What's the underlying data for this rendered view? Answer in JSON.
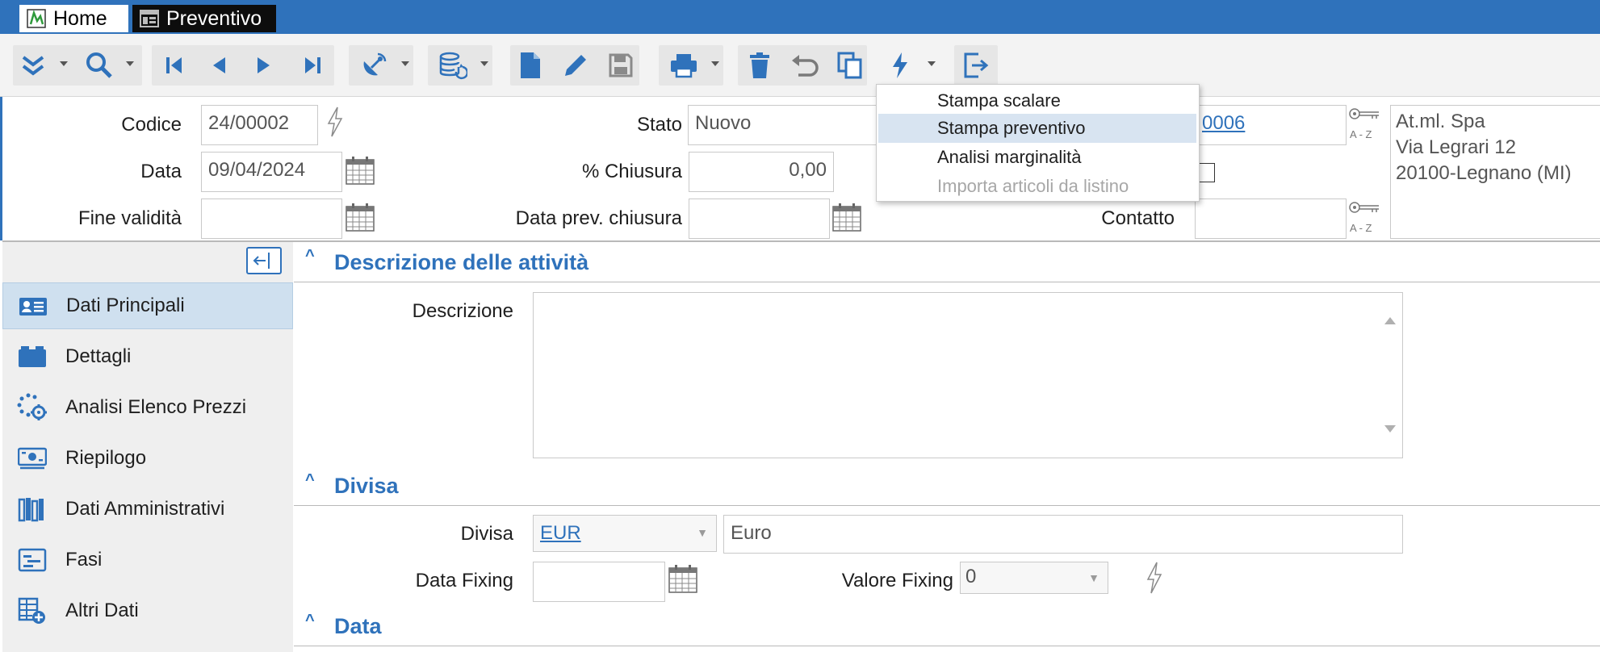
{
  "tabs": [
    {
      "label": "Home"
    },
    {
      "label": "Preventivo"
    }
  ],
  "header": {
    "codice_label": "Codice",
    "codice_value": "24/00002",
    "data_label": "Data",
    "data_value": "09/04/2024",
    "fine_label": "Fine validità",
    "fine_value": "",
    "stato_label": "Stato",
    "stato_value": "Nuovo",
    "chiusura_label": "% Chiusura",
    "chiusura_value": "0,00",
    "data_prev_label": "Data prev. chiusura",
    "data_prev_value": "",
    "cliente_code": "0006",
    "contatto_label": "Contatto",
    "contatto_value": "",
    "address_line1": "At.ml. Spa",
    "address_line2": "Via Legrari 12",
    "address_line3": "20100-Legnano (MI)"
  },
  "dropdown": {
    "items": [
      {
        "label": "Stampa scalare",
        "state": "normal"
      },
      {
        "label": "Stampa preventivo",
        "state": "selected"
      },
      {
        "label": "Analisi marginalità",
        "state": "normal"
      },
      {
        "label": "Importa articoli da listino",
        "state": "disabled"
      }
    ]
  },
  "sidebar": {
    "items": [
      {
        "label": "Dati Principali",
        "icon": "id-card-icon"
      },
      {
        "label": "Dettagli",
        "icon": "folder-icon"
      },
      {
        "label": "Analisi Elenco Prezzi",
        "icon": "dots-gear-icon"
      },
      {
        "label": "Riepilogo",
        "icon": "banknote-icon"
      },
      {
        "label": "Dati Amministrativi",
        "icon": "books-icon"
      },
      {
        "label": "Fasi",
        "icon": "list-icon"
      },
      {
        "label": "Altri Dati",
        "icon": "table-add-icon"
      }
    ]
  },
  "sections": {
    "descrizione_title": "Descrizione delle attività",
    "descrizione_label": "Descrizione",
    "descrizione_value": "",
    "divisa_title": "Divisa",
    "divisa_label": "Divisa",
    "divisa_code": "EUR",
    "divisa_desc": "Euro",
    "data_fixing_label": "Data Fixing",
    "data_fixing_value": "",
    "valore_fixing_label": "Valore Fixing",
    "valore_fixing_value": "0",
    "data_title": "Data"
  },
  "colors": {
    "accent": "#2f72bb",
    "sidebar_bg": "#efefef",
    "sidebar_active": "#cfe0ef"
  }
}
